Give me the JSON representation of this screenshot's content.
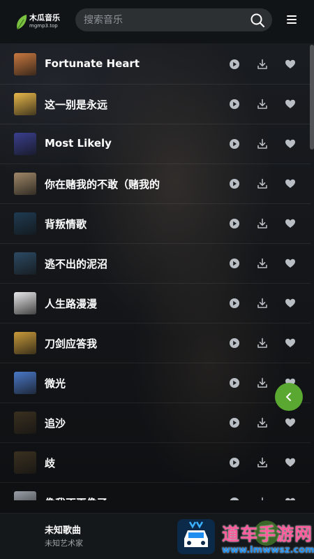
{
  "app": {
    "logo_title": "木瓜音乐",
    "logo_sub": "mgmp3.top",
    "accent": "#5aa832"
  },
  "search": {
    "placeholder": "搜索音乐",
    "icon": "search-icon"
  },
  "menu": {
    "icon": "hamburger-menu-icon"
  },
  "songs": [
    {
      "title": "Fortunate Heart",
      "cover": "#c9783f"
    },
    {
      "title": "这一别是永远",
      "cover": "#e8b84a"
    },
    {
      "title": "Most Likely",
      "cover": "#3a3f8e"
    },
    {
      "title": "你在赌我的不敢（赌我的",
      "cover": "#a08868"
    },
    {
      "title": "背叛情歌",
      "cover": "#1f3b52"
    },
    {
      "title": "逃不出的泥沼",
      "cover": "#2c4a63"
    },
    {
      "title": "人生路漫漫",
      "cover": "#e8e8ea"
    },
    {
      "title": "刀剑应答我",
      "cover": "#c89a3a"
    },
    {
      "title": "微光",
      "cover": "#4a78c8"
    },
    {
      "title": "追沙",
      "cover": "#3a3020"
    },
    {
      "title": "歧",
      "cover": "#3a3020"
    },
    {
      "title": "像我不再像了",
      "cover": "#9aa0a8"
    }
  ],
  "row_actions": {
    "play_icon": "play-icon",
    "download_icon": "download-icon",
    "favorite_icon": "heart-icon"
  },
  "player": {
    "title": "未知歌曲",
    "artist": "未知艺术家"
  },
  "watermark": {
    "text": "道车手游网",
    "url": "www.lmwwsz.com"
  }
}
